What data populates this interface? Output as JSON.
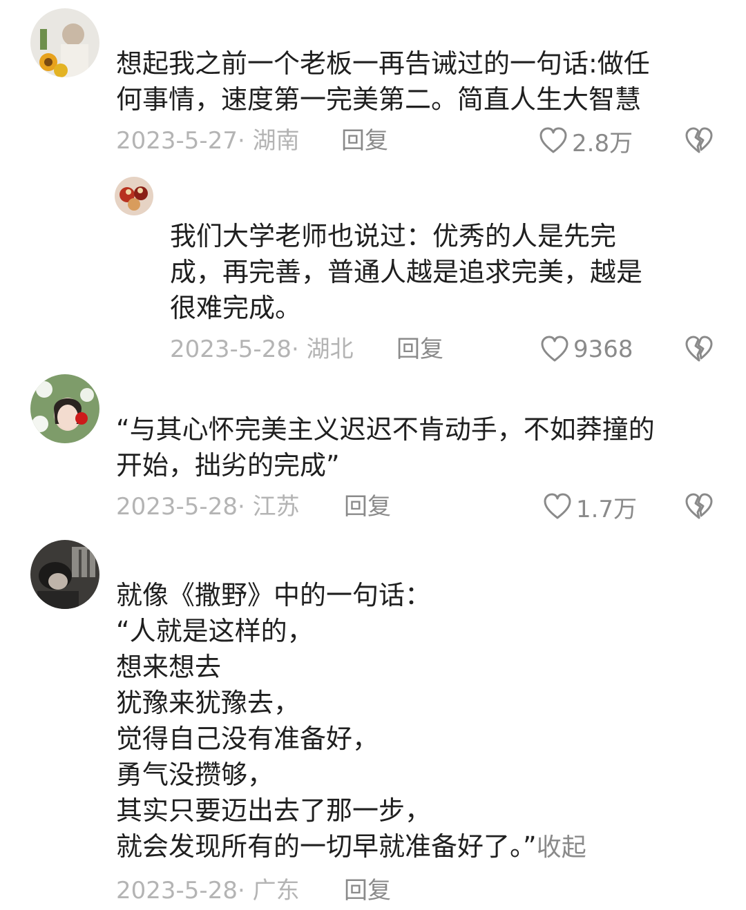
{
  "comments": [
    {
      "text": "想起我之前一个老板一再告诫过的一句话:做任\n何事情，速度第一完美第二。简直人生大智慧",
      "date": "2023-5-27· 湖南",
      "reply": "回复",
      "likes": "2.8万"
    },
    {
      "text": "我们大学老师也说过：优秀的人是先完\n成，再完善，普通人越是追求完美，越是\n很难完成。",
      "date": "2023-5-28· 湖北",
      "reply": "回复",
      "likes": "9368"
    },
    {
      "text": "“与其心怀完美主义迟迟不肯动手，不如莽撞的\n开始，拙劣的完成”",
      "date": "2023-5-28· 江苏",
      "reply": "回复",
      "likes": "1.7万"
    },
    {
      "text": "就像《撒野》中的一句话：\n“人就是这样的，\n想来想去\n犹豫来犹豫去，\n觉得自己没有准备好，\n勇气没攒够，\n其实只要迈出去了那一步，\n就会发现所有的一切早就准备好了。”",
      "collapse": "收起",
      "date": "2023-5-28· 广东",
      "reply": "回复"
    }
  ],
  "icons": {
    "like": "heart-outline-icon",
    "dislike": "broken-heart-icon"
  },
  "colors": {
    "text": "#1f1f1f",
    "meta": "#b4b4b4",
    "action": "#8a8a8a"
  }
}
